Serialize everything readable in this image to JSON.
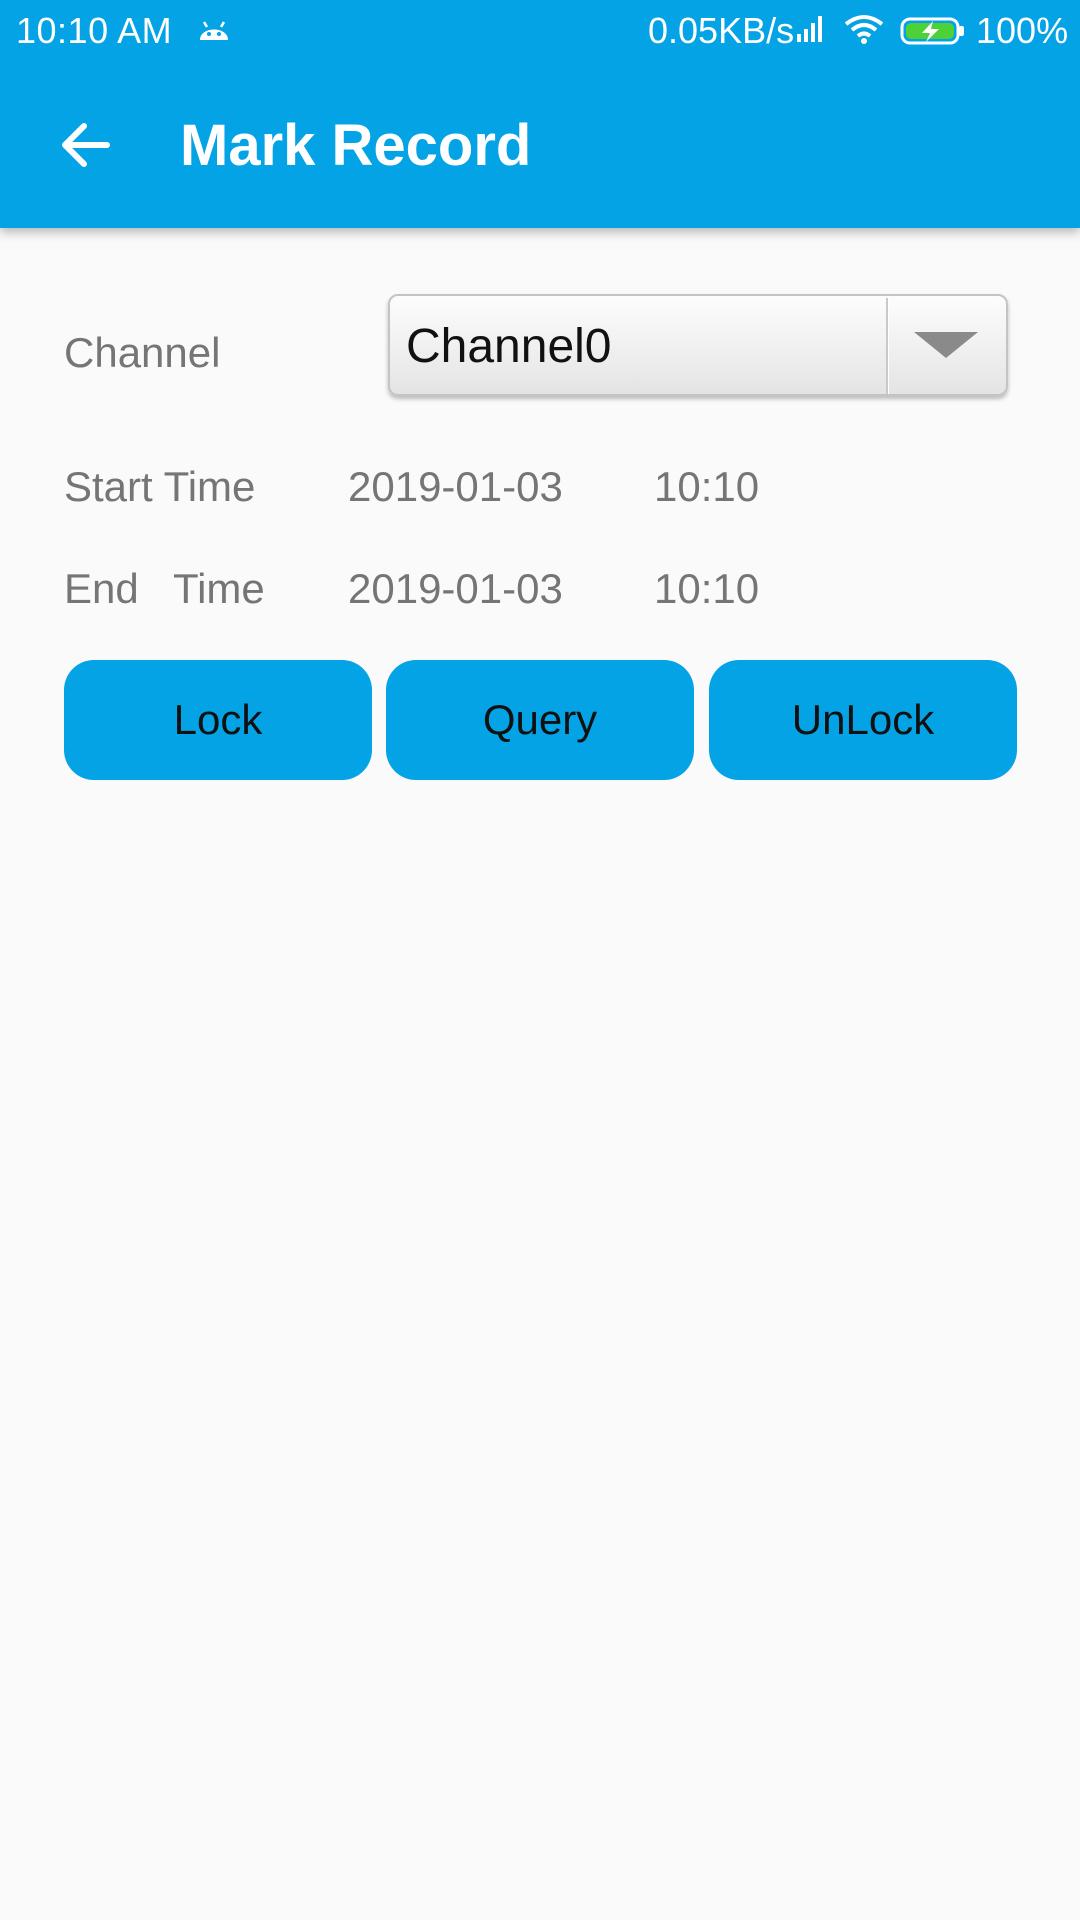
{
  "status_bar": {
    "time": "10:10  AM",
    "network_speed": "0.05KB/s",
    "battery_percent": "100%",
    "icons": [
      "android-notification-icon",
      "signal-icon",
      "wifi-icon",
      "battery-charging-icon"
    ]
  },
  "app_bar": {
    "title": "Mark Record",
    "back_icon": "arrow-left-icon"
  },
  "form": {
    "channel_label": "Channel",
    "channel_value": "Channel0",
    "start_label": "Start Time",
    "start_date": "2019-01-03",
    "start_time": "10:10",
    "end_label": "End   Time",
    "end_date": "2019-01-03",
    "end_time": "10:10"
  },
  "buttons": {
    "lock": "Lock",
    "query": "Query",
    "unlock": "UnLock"
  },
  "colors": {
    "primary": "#03a3e6",
    "background": "#fafafa",
    "label_text": "#757575",
    "button_text": "#111111"
  }
}
